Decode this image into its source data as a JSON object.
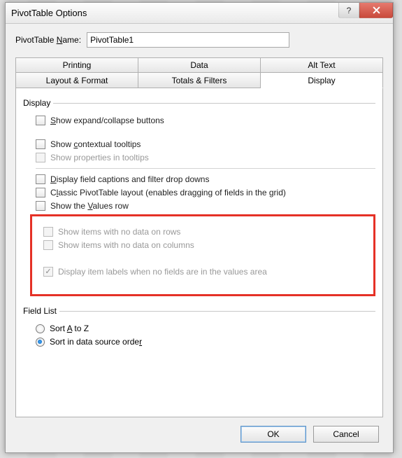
{
  "window": {
    "title": "PivotTable Options"
  },
  "name_field": {
    "label_pre": "PivotTable ",
    "label_ul": "N",
    "label_post": "ame:",
    "value": "PivotTable1"
  },
  "tabs": {
    "row1": [
      "Printing",
      "Data",
      "Alt Text"
    ],
    "row2": [
      "Layout & Format",
      "Totals & Filters",
      "Display"
    ],
    "active": "Display"
  },
  "groups": {
    "display_legend": "Display",
    "fieldlist_legend": "Field List"
  },
  "opts": {
    "expand": {
      "pre": "",
      "ul": "S",
      "post": "how expand/collapse buttons"
    },
    "tooltips": {
      "pre": "Show ",
      "ul": "c",
      "post": "ontextual tooltips"
    },
    "properties": "Show properties in tooltips",
    "captions": {
      "pre": "",
      "ul": "D",
      "post": "isplay field captions and filter drop downs"
    },
    "classic": {
      "pre": "C",
      "ul": "l",
      "post": "assic PivotTable layout (enables dragging of fields in the grid)"
    },
    "valuesrow": {
      "pre": "Show the ",
      "ul": "V",
      "post": "alues row"
    },
    "nodata_rows": "Show items with no data on rows",
    "nodata_cols": "Show items with no data on columns",
    "itemlabels": "Display item labels when no fields are in the values area"
  },
  "radios": {
    "az": {
      "pre": "Sort ",
      "ul": "A",
      "post": " to Z"
    },
    "source": {
      "pre": "Sort in data source orde",
      "ul": "r",
      "post": ""
    }
  },
  "buttons": {
    "ok": "OK",
    "cancel": "Cancel"
  }
}
